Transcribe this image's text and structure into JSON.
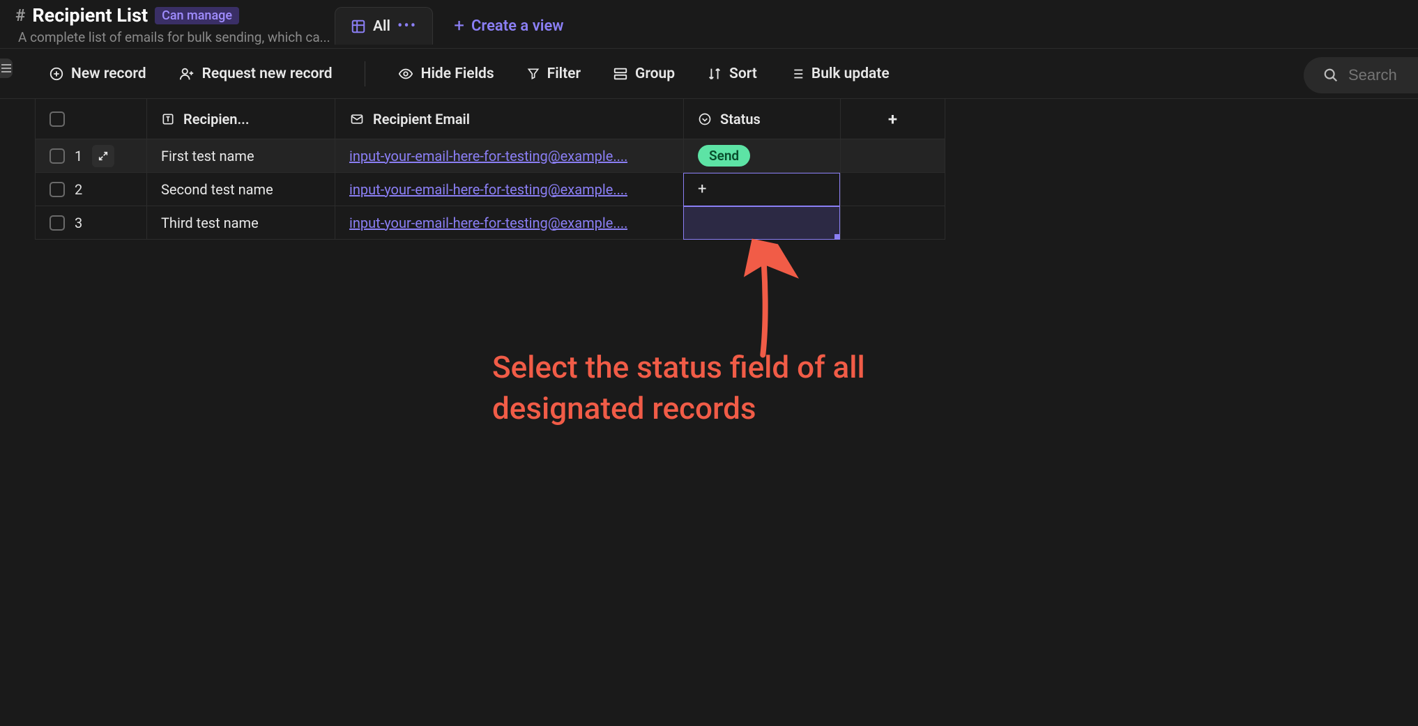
{
  "header": {
    "title": "Recipient List",
    "badge": "Can manage",
    "subtitle": "A complete list of emails for bulk sending, which ca..."
  },
  "tabs": {
    "active_label": "All",
    "create_view_label": "Create a view"
  },
  "toolbar": {
    "new_record": "New record",
    "request_new_record": "Request new record",
    "hide_fields": "Hide Fields",
    "filter": "Filter",
    "group": "Group",
    "sort": "Sort",
    "bulk_update": "Bulk update",
    "search_placeholder": "Search"
  },
  "columns": {
    "recipient_name": "Recipien...",
    "recipient_email": "Recipient Email",
    "status": "Status"
  },
  "rows": [
    {
      "num": "1",
      "name": "First test name",
      "email": "input-your-email-here-for-testing@example....",
      "status": "Send"
    },
    {
      "num": "2",
      "name": "Second test name",
      "email": "input-your-email-here-for-testing@example....",
      "status": ""
    },
    {
      "num": "3",
      "name": "Third test name",
      "email": "input-your-email-here-for-testing@example....",
      "status": ""
    }
  ],
  "annotation": {
    "line1": "Select the status field of all",
    "line2": "designated records"
  }
}
